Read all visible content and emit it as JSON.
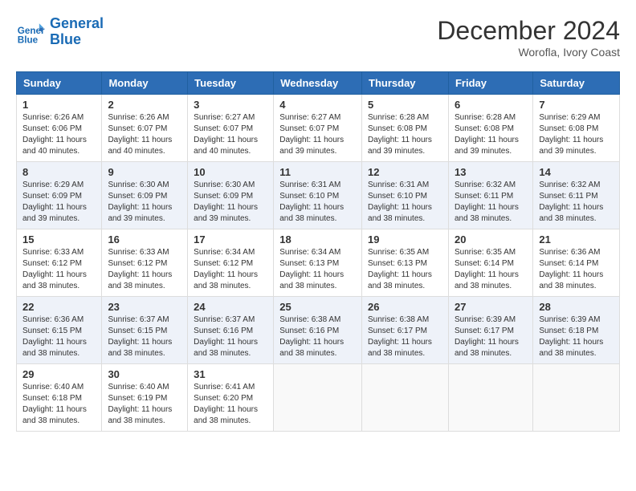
{
  "header": {
    "logo_line1": "General",
    "logo_line2": "Blue",
    "month": "December 2024",
    "location": "Worofla, Ivory Coast"
  },
  "weekdays": [
    "Sunday",
    "Monday",
    "Tuesday",
    "Wednesday",
    "Thursday",
    "Friday",
    "Saturday"
  ],
  "weeks": [
    [
      {
        "day": "1",
        "sunrise": "6:26 AM",
        "sunset": "6:06 PM",
        "daylight": "11 hours and 40 minutes."
      },
      {
        "day": "2",
        "sunrise": "6:26 AM",
        "sunset": "6:07 PM",
        "daylight": "11 hours and 40 minutes."
      },
      {
        "day": "3",
        "sunrise": "6:27 AM",
        "sunset": "6:07 PM",
        "daylight": "11 hours and 40 minutes."
      },
      {
        "day": "4",
        "sunrise": "6:27 AM",
        "sunset": "6:07 PM",
        "daylight": "11 hours and 39 minutes."
      },
      {
        "day": "5",
        "sunrise": "6:28 AM",
        "sunset": "6:08 PM",
        "daylight": "11 hours and 39 minutes."
      },
      {
        "day": "6",
        "sunrise": "6:28 AM",
        "sunset": "6:08 PM",
        "daylight": "11 hours and 39 minutes."
      },
      {
        "day": "7",
        "sunrise": "6:29 AM",
        "sunset": "6:08 PM",
        "daylight": "11 hours and 39 minutes."
      }
    ],
    [
      {
        "day": "8",
        "sunrise": "6:29 AM",
        "sunset": "6:09 PM",
        "daylight": "11 hours and 39 minutes."
      },
      {
        "day": "9",
        "sunrise": "6:30 AM",
        "sunset": "6:09 PM",
        "daylight": "11 hours and 39 minutes."
      },
      {
        "day": "10",
        "sunrise": "6:30 AM",
        "sunset": "6:09 PM",
        "daylight": "11 hours and 39 minutes."
      },
      {
        "day": "11",
        "sunrise": "6:31 AM",
        "sunset": "6:10 PM",
        "daylight": "11 hours and 38 minutes."
      },
      {
        "day": "12",
        "sunrise": "6:31 AM",
        "sunset": "6:10 PM",
        "daylight": "11 hours and 38 minutes."
      },
      {
        "day": "13",
        "sunrise": "6:32 AM",
        "sunset": "6:11 PM",
        "daylight": "11 hours and 38 minutes."
      },
      {
        "day": "14",
        "sunrise": "6:32 AM",
        "sunset": "6:11 PM",
        "daylight": "11 hours and 38 minutes."
      }
    ],
    [
      {
        "day": "15",
        "sunrise": "6:33 AM",
        "sunset": "6:12 PM",
        "daylight": "11 hours and 38 minutes."
      },
      {
        "day": "16",
        "sunrise": "6:33 AM",
        "sunset": "6:12 PM",
        "daylight": "11 hours and 38 minutes."
      },
      {
        "day": "17",
        "sunrise": "6:34 AM",
        "sunset": "6:12 PM",
        "daylight": "11 hours and 38 minutes."
      },
      {
        "day": "18",
        "sunrise": "6:34 AM",
        "sunset": "6:13 PM",
        "daylight": "11 hours and 38 minutes."
      },
      {
        "day": "19",
        "sunrise": "6:35 AM",
        "sunset": "6:13 PM",
        "daylight": "11 hours and 38 minutes."
      },
      {
        "day": "20",
        "sunrise": "6:35 AM",
        "sunset": "6:14 PM",
        "daylight": "11 hours and 38 minutes."
      },
      {
        "day": "21",
        "sunrise": "6:36 AM",
        "sunset": "6:14 PM",
        "daylight": "11 hours and 38 minutes."
      }
    ],
    [
      {
        "day": "22",
        "sunrise": "6:36 AM",
        "sunset": "6:15 PM",
        "daylight": "11 hours and 38 minutes."
      },
      {
        "day": "23",
        "sunrise": "6:37 AM",
        "sunset": "6:15 PM",
        "daylight": "11 hours and 38 minutes."
      },
      {
        "day": "24",
        "sunrise": "6:37 AM",
        "sunset": "6:16 PM",
        "daylight": "11 hours and 38 minutes."
      },
      {
        "day": "25",
        "sunrise": "6:38 AM",
        "sunset": "6:16 PM",
        "daylight": "11 hours and 38 minutes."
      },
      {
        "day": "26",
        "sunrise": "6:38 AM",
        "sunset": "6:17 PM",
        "daylight": "11 hours and 38 minutes."
      },
      {
        "day": "27",
        "sunrise": "6:39 AM",
        "sunset": "6:17 PM",
        "daylight": "11 hours and 38 minutes."
      },
      {
        "day": "28",
        "sunrise": "6:39 AM",
        "sunset": "6:18 PM",
        "daylight": "11 hours and 38 minutes."
      }
    ],
    [
      {
        "day": "29",
        "sunrise": "6:40 AM",
        "sunset": "6:18 PM",
        "daylight": "11 hours and 38 minutes."
      },
      {
        "day": "30",
        "sunrise": "6:40 AM",
        "sunset": "6:19 PM",
        "daylight": "11 hours and 38 minutes."
      },
      {
        "day": "31",
        "sunrise": "6:41 AM",
        "sunset": "6:20 PM",
        "daylight": "11 hours and 38 minutes."
      },
      null,
      null,
      null,
      null
    ]
  ]
}
